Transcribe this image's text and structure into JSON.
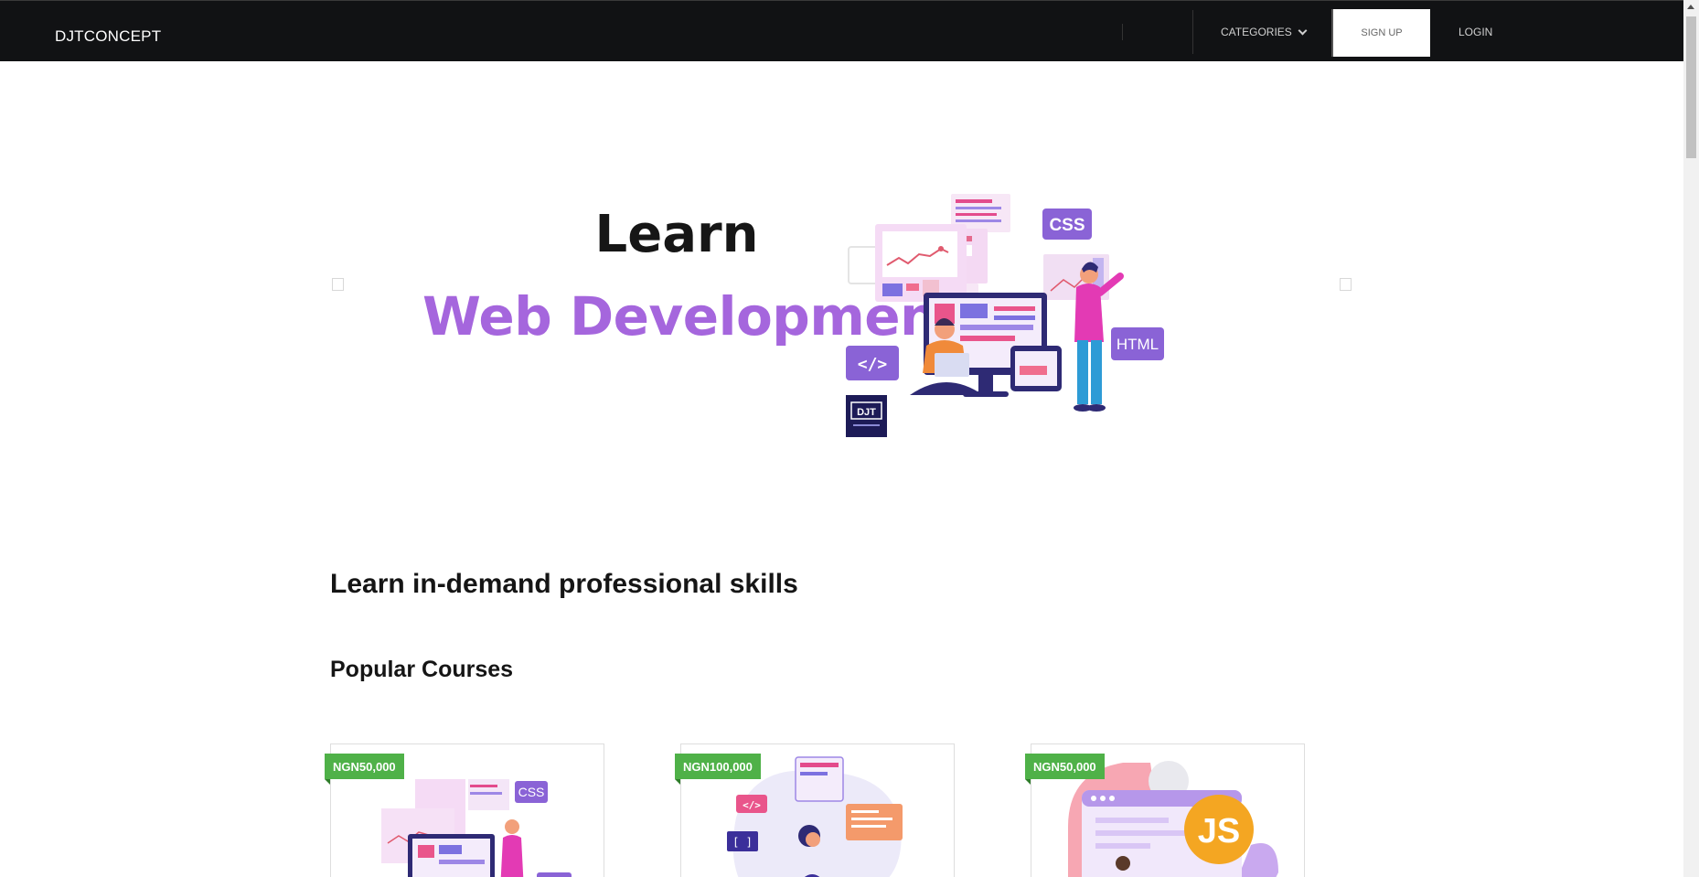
{
  "navbar": {
    "brand": "DJTCONCEPT",
    "categories_label": "CATEGORIES",
    "signup_label": "SIGN UP",
    "login_label": "LOGIN"
  },
  "hero": {
    "line1": "Learn",
    "line2": "Web Development",
    "art": {
      "badge_css": "CSS",
      "badge_html": "HTML",
      "badge_code": "</>",
      "logo": "DJT"
    }
  },
  "main": {
    "heading": "Learn in-demand professional skills",
    "subheading": "Popular Courses"
  },
  "courses": [
    {
      "price": "NGN50,000",
      "art_badge": "CSS"
    },
    {
      "price": "NGN100,000",
      "art_badge": "</>"
    },
    {
      "price": "NGN50,000",
      "art_badge": "JS"
    }
  ],
  "colors": {
    "navbar_bg": "#111214",
    "accent_purple": "#a566dd",
    "badge_green": "#4fb148"
  }
}
